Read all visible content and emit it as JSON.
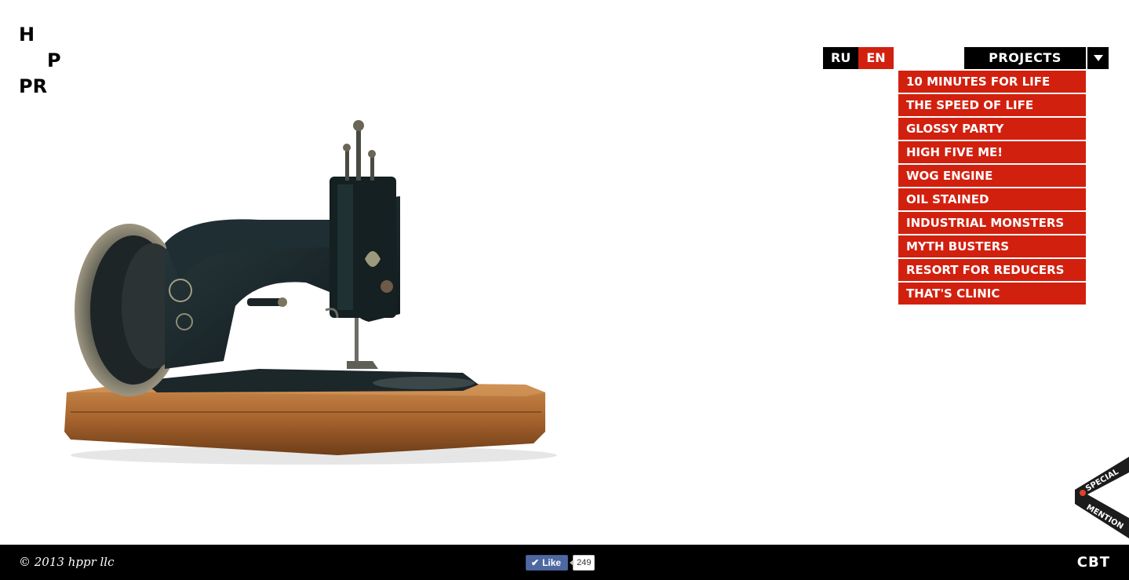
{
  "logo": {
    "line1": "H",
    "line2": "P",
    "line3": "PR"
  },
  "hero": {
    "subject": "sewing-machine-image"
  },
  "language": {
    "options": [
      "RU",
      "EN"
    ],
    "active": "EN"
  },
  "projects": {
    "label": "PROJECTS",
    "items": [
      "10 MINUTES FOR LIFE",
      "THE SPEED OF LIFE",
      "GLOSSY PARTY",
      "HIGH FIVE ME!",
      "WOG ENGINE",
      "OIL STAINED",
      "INDUSTRIAL MONSTERS",
      "MYTH BUSTERS",
      "RESORT FOR REDUCERS",
      "THAT'S CLINIC"
    ]
  },
  "ribbon": {
    "line1": "SPECIAL",
    "line2": "MENTION"
  },
  "footer": {
    "copyright": "© 2013 hppr llc",
    "like_label": "Like",
    "like_count": "249",
    "brand": "CBT"
  },
  "colors": {
    "accent": "#d2200f",
    "dark": "#000000",
    "facebook": "#4e69a2"
  }
}
